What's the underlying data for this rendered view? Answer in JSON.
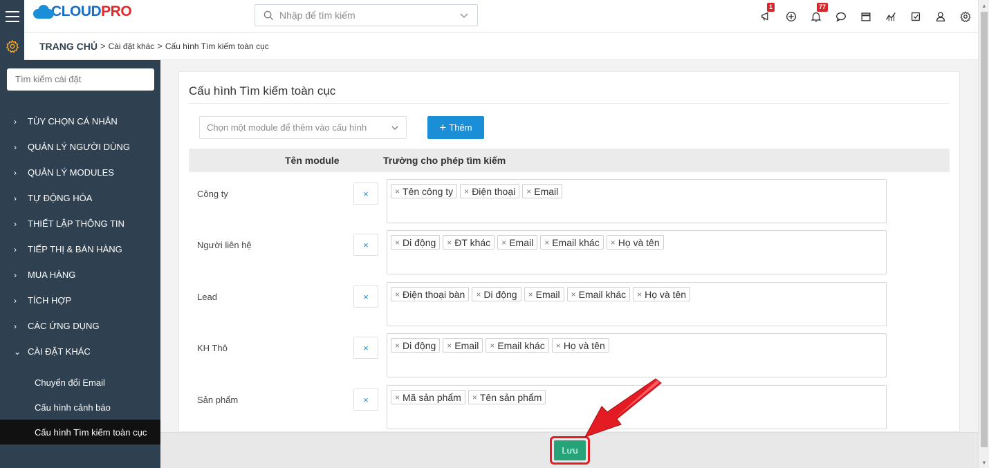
{
  "header": {
    "logo_main": "CLOUD",
    "logo_accent": "PRO",
    "search_placeholder": "Nhập để tìm kiếm",
    "notifications": {
      "announcement_badge": "1",
      "bell_badge": "77"
    }
  },
  "breadcrumb": {
    "home": "TRANG CHỦ",
    "separator": ">",
    "items": [
      "Cài đặt khác",
      "Cấu hình Tìm kiếm toàn cục"
    ]
  },
  "sidebar": {
    "search_placeholder": "Tìm kiếm cài đặt",
    "items": [
      {
        "label": "TÙY CHỌN CÁ NHÂN",
        "arrow": "›"
      },
      {
        "label": "QUẢN LÝ NGƯỜI DÙNG",
        "arrow": "›"
      },
      {
        "label": "QUẢN LÝ MODULES",
        "arrow": "›"
      },
      {
        "label": "TỰ ĐỘNG HÓA",
        "arrow": "›"
      },
      {
        "label": "THIẾT LẬP THÔNG TIN",
        "arrow": "›"
      },
      {
        "label": "TIẾP THỊ & BÁN HÀNG",
        "arrow": "›"
      },
      {
        "label": "MUA HÀNG",
        "arrow": "›"
      },
      {
        "label": "TÍCH HỢP",
        "arrow": "›"
      },
      {
        "label": "CÁC ỨNG DỤNG",
        "arrow": "›"
      },
      {
        "label": "CÀI ĐẶT KHÁC",
        "arrow": "⌄"
      }
    ],
    "subitems": [
      "Chuyển đổi Email",
      "Cấu hình cảnh báo",
      "Cấu hình Tìm kiếm toàn cục"
    ]
  },
  "main": {
    "title": "Cấu hình Tìm kiếm toàn cục",
    "module_select_placeholder": "Chọn một module để thêm vào cấu hình",
    "add_button": "Thêm",
    "table_headers": {
      "module": "Tên module",
      "fields": "Trường cho phép tìm kiếm"
    },
    "remove_symbol": "×",
    "rows": [
      {
        "module": "Công ty",
        "fields": [
          "Tên công ty",
          "Điện thoại",
          "Email"
        ]
      },
      {
        "module": "Người liên hệ",
        "fields": [
          "Di động",
          "ĐT khác",
          "Email",
          "Email khác",
          "Họ và tên"
        ]
      },
      {
        "module": "Lead",
        "fields": [
          "Điện thoại bàn",
          "Di động",
          "Email",
          "Email khác",
          "Họ và tên"
        ]
      },
      {
        "module": "KH Thô",
        "fields": [
          "Di động",
          "Email",
          "Email khác",
          "Họ và tên"
        ]
      },
      {
        "module": "Sản phẩm",
        "fields": [
          "Mã sản phẩm",
          "Tên sản phẩm"
        ]
      }
    ],
    "save_button": "Lưu"
  },
  "colors": {
    "sidebar_bg": "#2f4050",
    "primary": "#1a8fd8",
    "save": "#27a37a",
    "highlight": "#e31b23",
    "badge": "#d9262c"
  }
}
